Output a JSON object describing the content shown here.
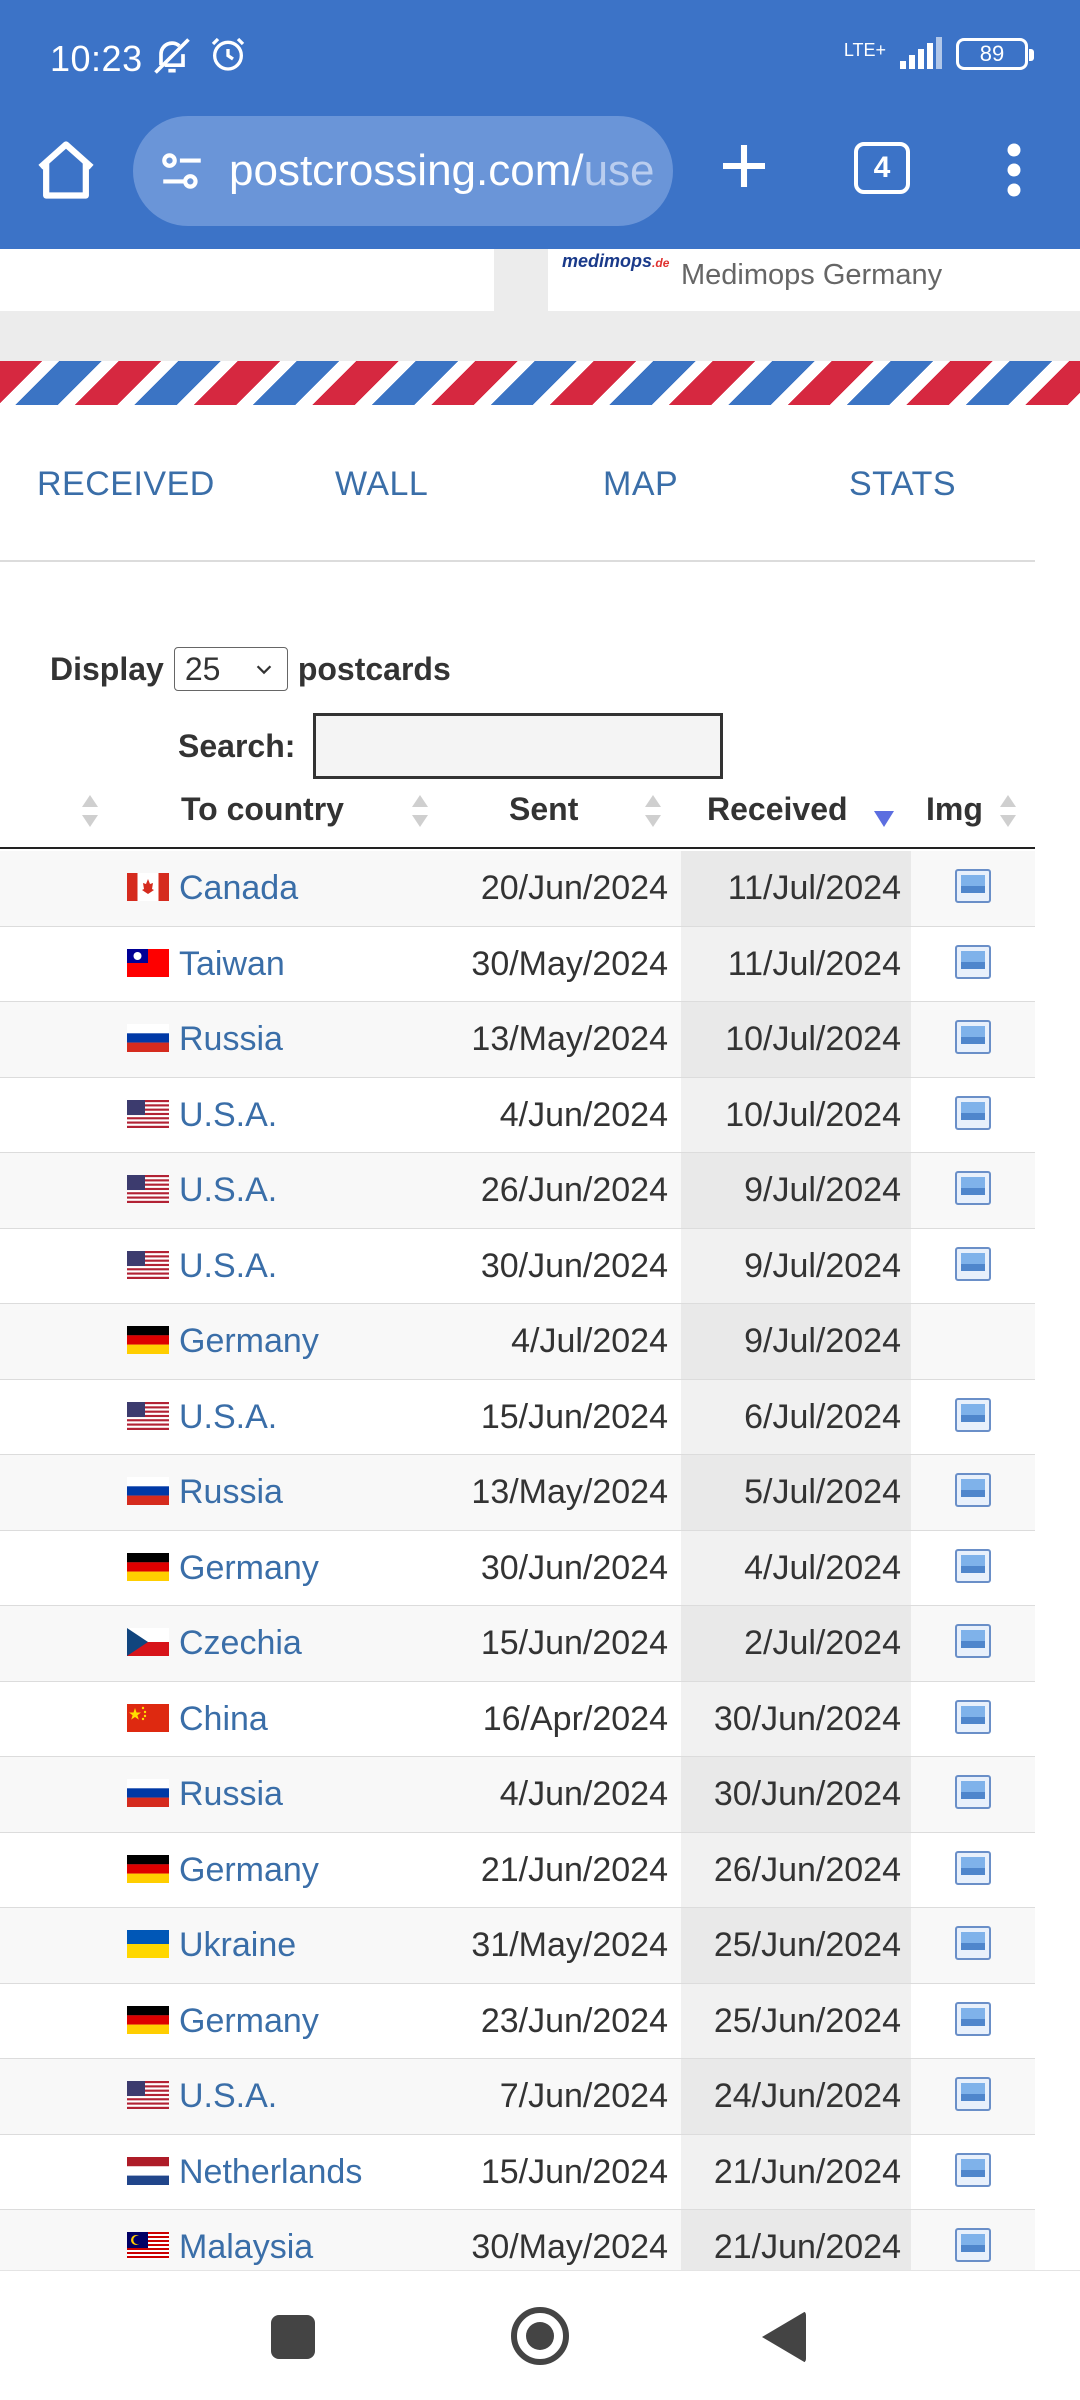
{
  "status": {
    "time": "10:23",
    "network": "LTE+",
    "battery": "89"
  },
  "toolbar": {
    "url_main": "postcrossing.com/",
    "url_rest": "use",
    "tab_count": "4"
  },
  "ad": {
    "logo": "medimops",
    "logo_suffix": ".de",
    "text": "Medimops Germany"
  },
  "nav": {
    "received": "RECEIVED",
    "wall": "WALL",
    "map": "MAP",
    "stats": "STATS"
  },
  "controls": {
    "display_label": "Display",
    "display_value": "25",
    "postcards_label": "postcards",
    "search_label": "Search:"
  },
  "table": {
    "headers": {
      "country": "To country",
      "sent": "Sent",
      "received": "Received",
      "img": "Img"
    },
    "rows": [
      {
        "flag": "CA",
        "country": "Canada",
        "sent": "20/Jun/2024",
        "received": "11/Jul/2024",
        "img": true
      },
      {
        "flag": "TW",
        "country": "Taiwan",
        "sent": "30/May/2024",
        "received": "11/Jul/2024",
        "img": true
      },
      {
        "flag": "RU",
        "country": "Russia",
        "sent": "13/May/2024",
        "received": "10/Jul/2024",
        "img": true
      },
      {
        "flag": "US",
        "country": "U.S.A.",
        "sent": "4/Jun/2024",
        "received": "10/Jul/2024",
        "img": true
      },
      {
        "flag": "US",
        "country": "U.S.A.",
        "sent": "26/Jun/2024",
        "received": "9/Jul/2024",
        "img": true
      },
      {
        "flag": "US",
        "country": "U.S.A.",
        "sent": "30/Jun/2024",
        "received": "9/Jul/2024",
        "img": true
      },
      {
        "flag": "DE",
        "country": "Germany",
        "sent": "4/Jul/2024",
        "received": "9/Jul/2024",
        "img": false
      },
      {
        "flag": "US",
        "country": "U.S.A.",
        "sent": "15/Jun/2024",
        "received": "6/Jul/2024",
        "img": true
      },
      {
        "flag": "RU",
        "country": "Russia",
        "sent": "13/May/2024",
        "received": "5/Jul/2024",
        "img": true
      },
      {
        "flag": "DE",
        "country": "Germany",
        "sent": "30/Jun/2024",
        "received": "4/Jul/2024",
        "img": true
      },
      {
        "flag": "CZ",
        "country": "Czechia",
        "sent": "15/Jun/2024",
        "received": "2/Jul/2024",
        "img": true
      },
      {
        "flag": "CN",
        "country": "China",
        "sent": "16/Apr/2024",
        "received": "30/Jun/2024",
        "img": true
      },
      {
        "flag": "RU",
        "country": "Russia",
        "sent": "4/Jun/2024",
        "received": "30/Jun/2024",
        "img": true
      },
      {
        "flag": "DE",
        "country": "Germany",
        "sent": "21/Jun/2024",
        "received": "26/Jun/2024",
        "img": true
      },
      {
        "flag": "UA",
        "country": "Ukraine",
        "sent": "31/May/2024",
        "received": "25/Jun/2024",
        "img": true
      },
      {
        "flag": "DE",
        "country": "Germany",
        "sent": "23/Jun/2024",
        "received": "25/Jun/2024",
        "img": true
      },
      {
        "flag": "US",
        "country": "U.S.A.",
        "sent": "7/Jun/2024",
        "received": "24/Jun/2024",
        "img": true
      },
      {
        "flag": "NL",
        "country": "Netherlands",
        "sent": "15/Jun/2024",
        "received": "21/Jun/2024",
        "img": true
      },
      {
        "flag": "MY",
        "country": "Malaysia",
        "sent": "30/May/2024",
        "received": "21/Jun/2024",
        "img": true
      }
    ]
  },
  "colors": {
    "chrome": "#3c73c7",
    "link": "#3a6ea8",
    "stripe_red": "#d62840",
    "stripe_blue": "#3b74c4",
    "sort_active": "#5c6ee0"
  }
}
